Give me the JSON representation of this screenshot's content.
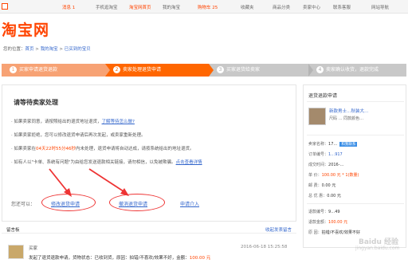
{
  "topbar": {
    "messages": "消息 1",
    "mobile": "手机逛淘宝",
    "home": "淘宝网首页",
    "my_taobao": "我的淘宝",
    "cart": "购物车 25",
    "favorites": "收藏夹",
    "categories": "商品分类",
    "seller_center": "卖家中心",
    "contact": "联系客服",
    "site_nav": "网站导航"
  },
  "logo": "淘宝网",
  "breadcrumb": {
    "prefix": "您的位置：",
    "items": [
      "首页",
      "我的淘宝",
      "已买到的宝贝"
    ],
    "separator": " > "
  },
  "steps": [
    {
      "num": "1",
      "label": "买家申请退货退款"
    },
    {
      "num": "2",
      "label": "卖家处理退货申请"
    },
    {
      "num": "3",
      "label": "买家退货给卖家"
    },
    {
      "num": "4",
      "label": "卖家确认收货，退款完成"
    }
  ],
  "main": {
    "title": "请等待卖家处理",
    "lines": [
      {
        "a": "如果卖家同意，请按照给出的退货地址退货，",
        "link": "了解等待怎么做?"
      },
      {
        "a": "如果卖家拒绝，您可以修改退货申请后再次发起，或卖家重新处理。"
      },
      {
        "a": "如果卖家在",
        "hl": "04天22时55分46秒",
        "b": "内未处理，退货申请将自动达成，请按系统给出的地址退货。"
      },
      {
        "a": "如有人以\"卡单、系统有问题\"为由给您发送退款相关链接，请勿相信，以免被欺骗。",
        "link": "点击查看详情"
      }
    ],
    "actions_label": "您还可以：",
    "modify_btn": "修改退货申请",
    "cancel_btn": "撤消退货申请",
    "intervene_btn": "申请介入"
  },
  "side": {
    "title": "退货退款申请",
    "goods_name": "新款男士…秋装大…",
    "goods_sub": "尺码 …  同款颜色…",
    "seller_label": "卖家名称：",
    "seller_val": "17…",
    "seller_badge": "和我联系",
    "order_label": "订单编号：",
    "order_val": "1…917",
    "txn_label": "成交时间：",
    "txn_val": "2016-…",
    "unit_label": "单 价：",
    "unit_val": "100.00 元 * 1(数量)",
    "ship_label": "邮 费：",
    "ship_val": "0.00 元",
    "total_label": "总 优 惠：",
    "total_val": "0.00 元",
    "refund_no_label": "退款编号：",
    "refund_no_val": "9…49",
    "refund_amt_label": "退款金额：",
    "refund_amt_val": "100.00 元",
    "reason_label": "原 因：",
    "reason_val": "拍错/不喜欢/效果不好"
  },
  "messages": {
    "title": "留言板",
    "more": "收起发表留言",
    "items": [
      {
        "who": "买家",
        "body": "发起了退货退款申请，货物状态：已收到货，原因：拍错/不喜欢/效果不好，金额：",
        "amount": "100.00 元",
        "time": "2016-06-18 15:25:58"
      }
    ]
  },
  "watermark": "Baidu 经验",
  "watermark_url": "jingyan.baidu.com"
}
